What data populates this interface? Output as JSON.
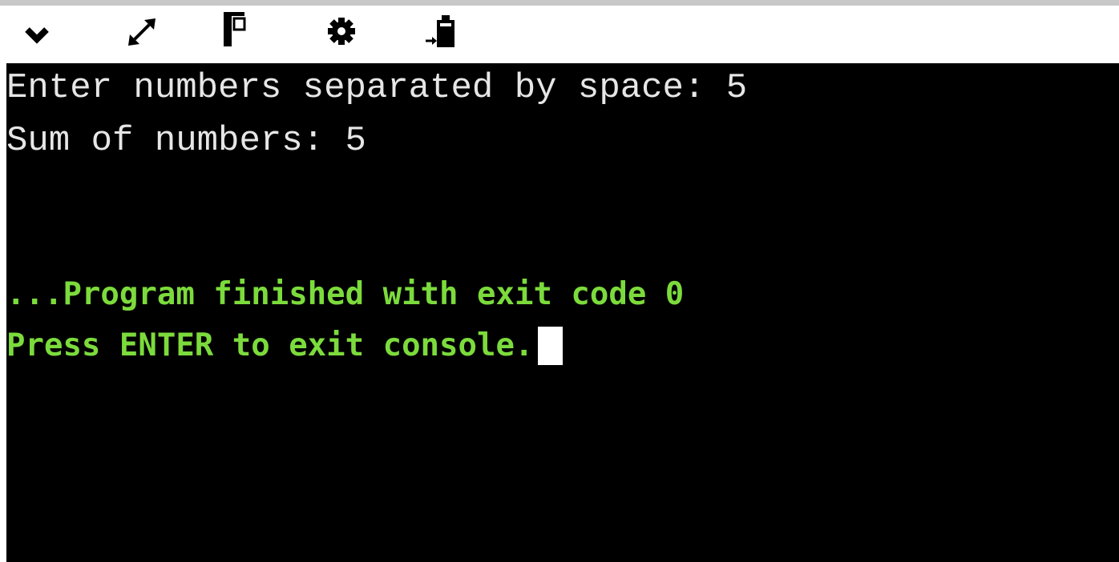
{
  "toolbar": {
    "buttons": [
      {
        "icon": "chevron-down-icon"
      },
      {
        "icon": "expand-icon"
      },
      {
        "icon": "split-panel-icon"
      },
      {
        "icon": "gear-icon"
      },
      {
        "icon": "paste-icon"
      }
    ]
  },
  "console": {
    "output_lines": [
      "Enter numbers separated by space: 5",
      "Sum of numbers: 5"
    ],
    "status_lines": [
      "...Program finished with exit code 0",
      "Press ENTER to exit console."
    ]
  },
  "colors": {
    "console_background": "#000000",
    "output_text": "#e6e6e6",
    "status_text": "#7cdb3c",
    "toolbar_background": "#ffffff"
  }
}
